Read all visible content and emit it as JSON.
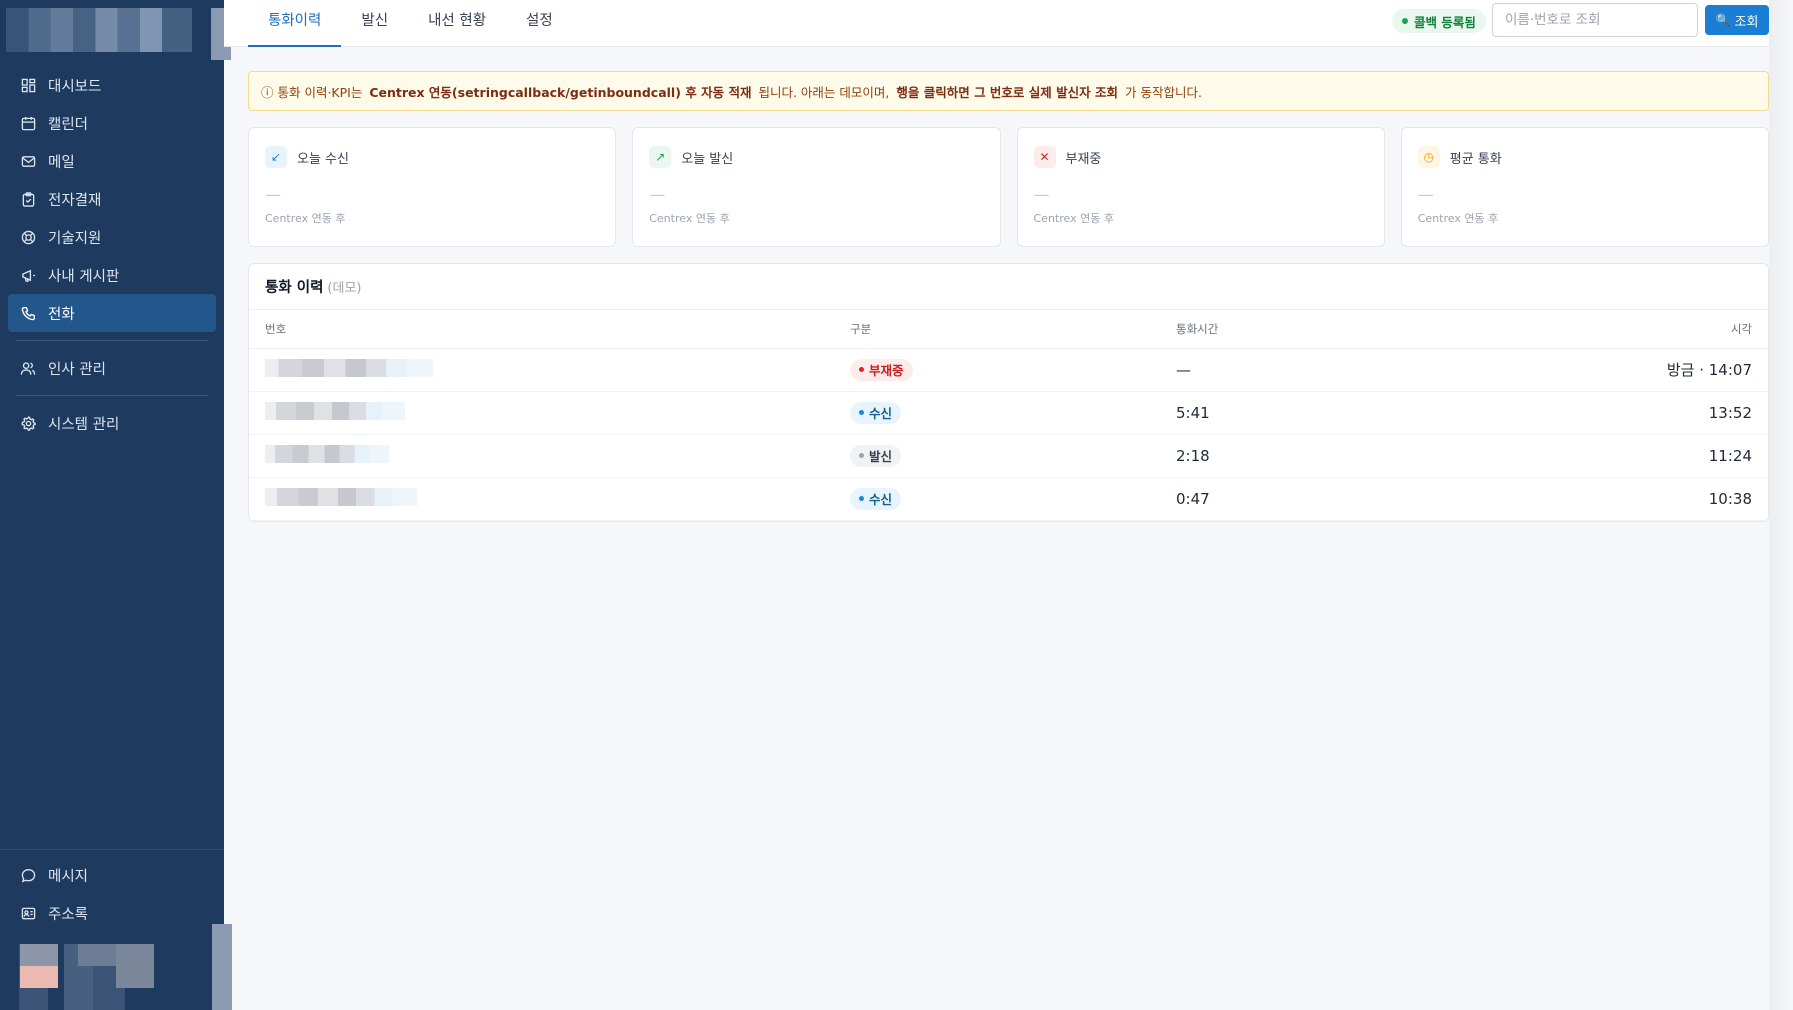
{
  "sidebar": {
    "items": [
      {
        "label": "대시보드",
        "icon": "dashboard-icon"
      },
      {
        "label": "캘린더",
        "icon": "calendar-icon"
      },
      {
        "label": "메일",
        "icon": "mail-icon"
      },
      {
        "label": "전자결재",
        "icon": "clipboard-check-icon"
      },
      {
        "label": "기술지원",
        "icon": "lifebuoy-icon"
      },
      {
        "label": "사내 게시판",
        "icon": "megaphone-icon"
      },
      {
        "label": "전화",
        "icon": "phone-icon",
        "active": true
      },
      {
        "label": "인사 관리",
        "icon": "users-icon"
      },
      {
        "label": "시스템 관리",
        "icon": "gear-icon"
      }
    ],
    "bottom_items": [
      {
        "label": "메시지",
        "icon": "chat-bubble-icon"
      },
      {
        "label": "주소록",
        "icon": "address-book-icon"
      }
    ]
  },
  "header": {
    "tabs": [
      {
        "label": "통화이력",
        "active": true
      },
      {
        "label": "발신"
      },
      {
        "label": "내선 현황"
      },
      {
        "label": "설정"
      }
    ],
    "status_badge": "콜백 등록됨",
    "search": {
      "placeholder": "이름·번호로 조회",
      "value": ""
    },
    "search_button": "조회"
  },
  "notice": {
    "prefix": "ⓘ 통화 이력·KPI는",
    "bold1": "Centrex 연동(setringcallback/getinboundcall) 후 자동 적재",
    "middle": "됩니다. 아래는 데모이며,",
    "bold2": "행을 클릭하면 그 번호로 실제 발신자 조회",
    "suffix": "가 동작합니다."
  },
  "kpis": [
    {
      "label": "오늘 수신",
      "value": "—",
      "sub": "Centrex 연동 후",
      "icon": "arrow-down-left-icon",
      "color": "#1a8ad4",
      "bg": "#e8f4fd"
    },
    {
      "label": "오늘 발신",
      "value": "—",
      "sub": "Centrex 연동 후",
      "icon": "arrow-up-right-icon",
      "color": "#16a34a",
      "bg": "#e9f7ef"
    },
    {
      "label": "부재중",
      "value": "—",
      "sub": "Centrex 연동 후",
      "icon": "x-icon",
      "color": "#dc2626",
      "bg": "#fdecec"
    },
    {
      "label": "평균 통화",
      "value": "—",
      "sub": "Centrex 연동 후",
      "icon": "clock-icon",
      "color": "#f59e0b",
      "bg": "#fef6e4"
    }
  ],
  "call_table": {
    "title": "통화 이력",
    "title_note": "(데모)",
    "columns": [
      "번호",
      "구분",
      "통화시간",
      "시각"
    ],
    "rows": [
      {
        "type": "부재중",
        "type_key": "missed",
        "duration": "—",
        "time": "방금 · 14:07"
      },
      {
        "type": "수신",
        "type_key": "in",
        "duration": "5:41",
        "time": "13:52"
      },
      {
        "type": "발신",
        "type_key": "out",
        "duration": "2:18",
        "time": "11:24"
      },
      {
        "type": "수신",
        "type_key": "in",
        "duration": "0:47",
        "time": "10:38"
      }
    ]
  },
  "colors": {
    "sidebar_bg": "#1e3a5f",
    "sidebar_active": "#23568a",
    "accent": "#1a7fd4",
    "notice_bg": "#fffbeb"
  }
}
